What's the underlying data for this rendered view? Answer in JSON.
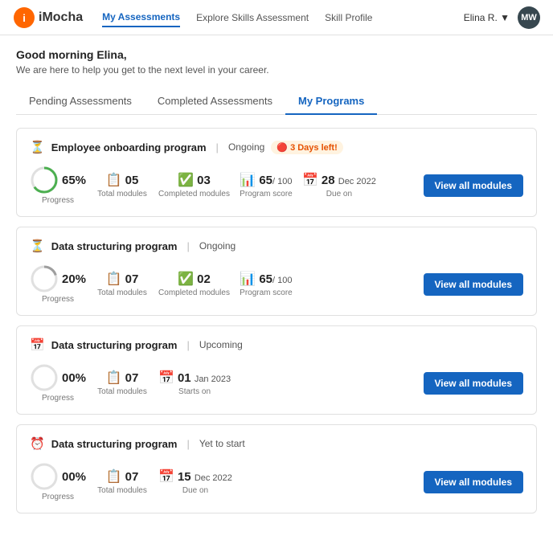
{
  "header": {
    "logo_text": "iMocha",
    "nav": [
      {
        "label": "My Assessments",
        "active": true
      },
      {
        "label": "Explore Skills Assessment",
        "active": false
      },
      {
        "label": "Skill Profile",
        "active": false
      }
    ],
    "user": "Elina R. ▼",
    "avatar": "MW"
  },
  "greeting": {
    "line1": "Good morning Elina,",
    "line2": "We are here to help you get to the next level in your career."
  },
  "tabs": [
    {
      "label": "Pending Assessments",
      "active": false
    },
    {
      "label": "Completed Assessments",
      "active": false
    },
    {
      "label": "My Programs",
      "active": true
    }
  ],
  "programs": [
    {
      "icon": "⏳",
      "title": "Employee onboarding program",
      "separator": "|",
      "status": "Ongoing",
      "badge": "3 Days left!",
      "show_badge": true,
      "progress_pct": 65,
      "progress_label": "Progress",
      "total_modules": "05",
      "total_modules_label": "Total modules",
      "completed_modules": "03",
      "completed_modules_label": "Completed modules",
      "program_score": "65",
      "program_score_max": "/ 100",
      "program_score_label": "Program score",
      "due_label": "Dec 2022",
      "due_meta": "28",
      "due_meta_label": "Due on",
      "show_due": true,
      "show_starts": false,
      "btn_label": "View all modules",
      "circle_color": "#4caf50",
      "circle_bg": "#e0e0e0"
    },
    {
      "icon": "⏳",
      "title": "Data structuring program",
      "separator": "|",
      "status": "Ongoing",
      "badge": "",
      "show_badge": false,
      "progress_pct": 20,
      "progress_label": "Progress",
      "total_modules": "07",
      "total_modules_label": "Total modules",
      "completed_modules": "02",
      "completed_modules_label": "Completed modules",
      "program_score": "65",
      "program_score_max": "/ 100",
      "program_score_label": "Program score",
      "due_label": "",
      "due_meta": "",
      "due_meta_label": "",
      "show_due": false,
      "show_starts": false,
      "btn_label": "View all modules",
      "circle_color": "#9e9e9e",
      "circle_bg": "#e0e0e0"
    },
    {
      "icon": "📅",
      "title": "Data structuring program",
      "separator": "|",
      "status": "Upcoming",
      "badge": "",
      "show_badge": false,
      "progress_pct": 0,
      "progress_label": "Progress",
      "total_modules": "07",
      "total_modules_label": "Total modules",
      "completed_modules": "",
      "completed_modules_label": "",
      "program_score": "",
      "program_score_max": "",
      "program_score_label": "",
      "due_label": "Jan 2023",
      "due_meta": "01",
      "due_meta_label": "Starts on",
      "show_due": true,
      "show_starts": true,
      "btn_label": "View all modules",
      "circle_color": "#e0e0e0",
      "circle_bg": "#e0e0e0"
    },
    {
      "icon": "⏰",
      "title": "Data structuring program",
      "separator": "|",
      "status": "Yet to start",
      "badge": "",
      "show_badge": false,
      "progress_pct": 0,
      "progress_label": "Progress",
      "total_modules": "07",
      "total_modules_label": "Total modules",
      "completed_modules": "",
      "completed_modules_label": "",
      "program_score": "",
      "program_score_max": "",
      "program_score_label": "",
      "due_label": "Dec 2022",
      "due_meta": "15",
      "due_meta_label": "Due on",
      "show_due": true,
      "show_starts": false,
      "btn_label": "View all modules",
      "circle_color": "#e0e0e0",
      "circle_bg": "#e0e0e0"
    }
  ]
}
